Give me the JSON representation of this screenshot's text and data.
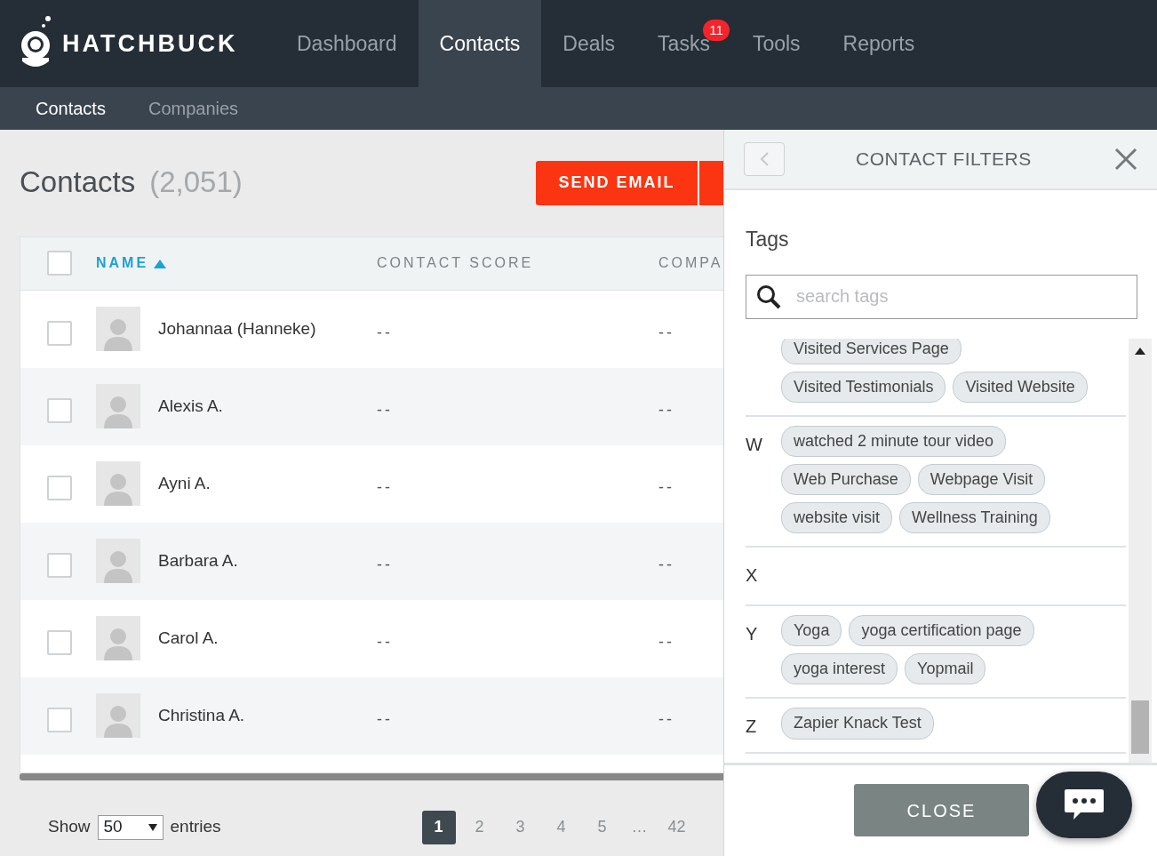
{
  "nav": {
    "brand": "HATCHBUCK",
    "items": [
      {
        "label": "Dashboard",
        "selected": false
      },
      {
        "label": "Contacts",
        "selected": true
      },
      {
        "label": "Deals",
        "selected": false
      },
      {
        "label": "Tasks",
        "selected": false,
        "badge": "11"
      },
      {
        "label": "Tools",
        "selected": false
      },
      {
        "label": "Reports",
        "selected": false
      }
    ]
  },
  "subnav": [
    {
      "label": "Contacts",
      "selected": true
    },
    {
      "label": "Companies",
      "selected": false
    }
  ],
  "page": {
    "title": "Contacts",
    "count": "(2,051)",
    "actions": [
      "SEND EMAIL"
    ]
  },
  "table": {
    "select_all_checked": false,
    "columns": [
      {
        "label": "NAME",
        "sorted": true
      },
      {
        "label": "CONTACT SCORE",
        "sorted": false
      },
      {
        "label": "COMPA",
        "sorted": false
      }
    ],
    "rows": [
      {
        "name": "Johannaa (Hanneke)",
        "score": "--",
        "company": "--",
        "checked": false
      },
      {
        "name": "Alexis A.",
        "score": "--",
        "company": "--",
        "checked": false
      },
      {
        "name": "Ayni A.",
        "score": "--",
        "company": "--",
        "checked": false
      },
      {
        "name": "Barbara A.",
        "score": "--",
        "company": "--",
        "checked": false
      },
      {
        "name": "Carol A.",
        "score": "--",
        "company": "--",
        "checked": false
      },
      {
        "name": "Christina A.",
        "score": "--",
        "company": "--",
        "checked": false
      }
    ]
  },
  "page_size": {
    "before": "Show",
    "value": "50",
    "after": "entries"
  },
  "pagination": [
    {
      "label": "1",
      "kind": "page",
      "selected": true
    },
    {
      "label": "2",
      "kind": "page",
      "selected": false
    },
    {
      "label": "3",
      "kind": "page",
      "selected": false
    },
    {
      "label": "4",
      "kind": "page",
      "selected": false
    },
    {
      "label": "5",
      "kind": "page",
      "selected": false
    },
    {
      "label": "…",
      "kind": "ellipsis"
    },
    {
      "label": "42",
      "kind": "page",
      "selected": false
    }
  ],
  "filters_panel": {
    "title": "CONTACT FILTERS",
    "section": "Tags",
    "search": {
      "placeholder": "search tags"
    },
    "groups": [
      {
        "tags": [
          "Visited Services Page",
          "Visited Testimonials",
          "Visited Website"
        ]
      },
      {
        "letter": "W",
        "tags": [
          "watched 2 minute tour video",
          "Web Purchase",
          "Webpage Visit",
          "website visit",
          "Wellness Training"
        ]
      },
      {
        "letter": "X"
      },
      {
        "letter": "Y",
        "tags": [
          "Yoga",
          "yoga certification page",
          "yoga interest",
          "Yopmail"
        ]
      },
      {
        "letter": "Z",
        "tags": [
          "Zapier Knack Test"
        ]
      }
    ],
    "close_button": "CLOSE"
  }
}
